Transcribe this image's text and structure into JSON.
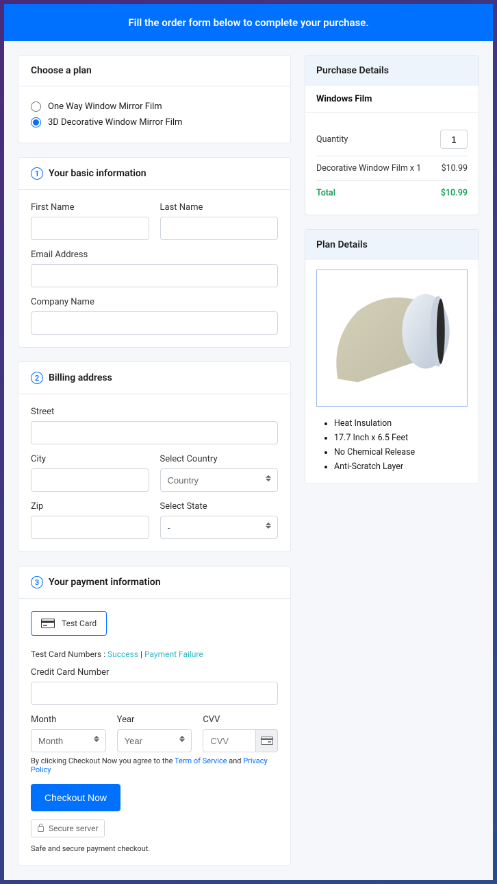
{
  "banner": "Fill the order form below to complete your purchase.",
  "plan_card": {
    "title": "Choose a plan",
    "options": [
      "One Way Window Mirror Film",
      "3D Decorative Window Mirror Film"
    ]
  },
  "basic": {
    "num": "1",
    "title": "Your basic information",
    "first_name": "First Name",
    "last_name": "Last Name",
    "email": "Email Address",
    "company": "Company Name"
  },
  "billing": {
    "num": "2",
    "title": "Billing address",
    "street": "Street",
    "city": "City",
    "country_label": "Select Country",
    "country_placeholder": "Country",
    "zip": "Zip",
    "state_label": "Select State",
    "state_placeholder": "-"
  },
  "payment": {
    "num": "3",
    "title": "Your payment information",
    "method": "Test  Card",
    "test_label": "Test Card Numbers : ",
    "success": "Success",
    "failure": "Payment Failure",
    "cc_label": "Credit Card Number",
    "month_label": "Month",
    "month_placeholder": "Month",
    "year_label": "Year",
    "year_placeholder": "Year",
    "cvv_label": "CVV",
    "cvv_placeholder": "CVV",
    "agree_pre": "By clicking Checkout Now you agree to the ",
    "tos": "Term of Service",
    "agree_mid": " and ",
    "privacy": "Privacy Policy",
    "checkout_btn": "Checkout Now",
    "secure": "Secure server",
    "safe": "Safe and secure payment checkout."
  },
  "purchase": {
    "title": "Purchase Details",
    "product": "Windows Film",
    "qty_label": "Quantity",
    "qty_value": "1",
    "line_label": "Decorative Window Film x 1",
    "line_price": "$10.99",
    "total_label": "Total",
    "total_value": "$10.99"
  },
  "plan_details": {
    "title": "Plan Details",
    "features": [
      "Heat Insulation",
      "17.7 Inch x 6.5 Feet",
      "No Chemical Release",
      "Anti-Scratch Layer"
    ]
  }
}
